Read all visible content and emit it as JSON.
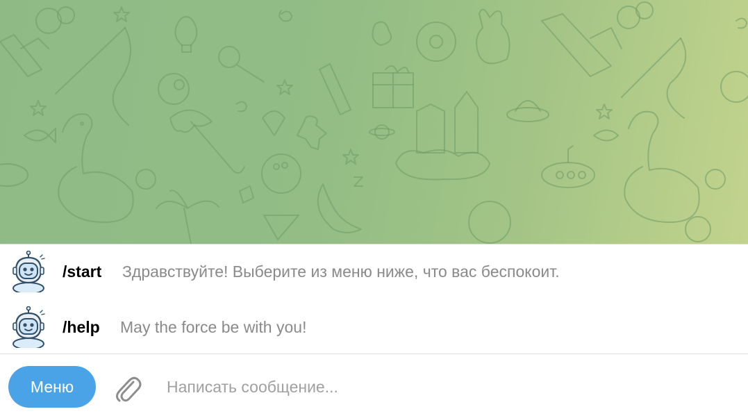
{
  "chat": {
    "background_colors": [
      "#8fba86",
      "#c2d38d"
    ],
    "pattern_color": "#6f9a66"
  },
  "commands": [
    {
      "name": "/start",
      "description": "Здравствуйте! Выберите из меню ниже, что вас беспокоит.",
      "avatar_icon": "robot-icon"
    },
    {
      "name": "/help",
      "description": "May the force be with you!",
      "avatar_icon": "robot-icon"
    }
  ],
  "composer": {
    "menu_label": "Меню",
    "menu_color": "#4aa3e6",
    "attach_icon": "paperclip-icon",
    "placeholder": "Написать сообщение..."
  }
}
